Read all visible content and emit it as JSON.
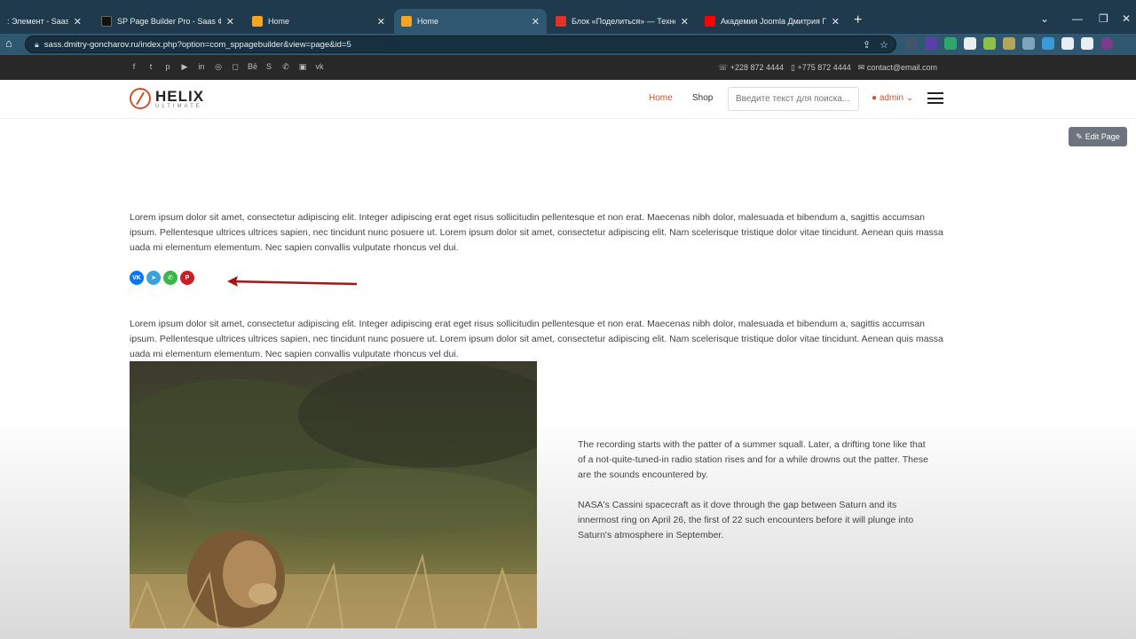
{
  "browser": {
    "tabs": [
      {
        "title": ": Элемент - Saas Фра",
        "icon_color": "#ffffff"
      },
      {
        "title": "SP Page Builder Pro - Saas Фрай",
        "icon_color": "#111111"
      },
      {
        "title": "Home",
        "icon_color": "#f4a623"
      },
      {
        "title": "Home",
        "icon_color": "#f4a623"
      },
      {
        "title": "Блок «Поделиться» — Техноло",
        "icon_color": "#e0342b"
      },
      {
        "title": "Академия Joomla Дмитрия Гон",
        "icon_color": "#ff0000"
      }
    ],
    "url": "sass.dmitry-goncharov.ru/index.php?option=com_sppagebuilder&view=page&id=5"
  },
  "topbar": {
    "phone1": "+228 872 4444",
    "phone2": "+775 872 4444",
    "email": "contact@email.com"
  },
  "header": {
    "logo_name": "HELIX",
    "logo_sub": "ULTIMATE",
    "nav_home": "Home",
    "nav_shop": "Shop",
    "search_placeholder": "Введите текст для поиска...",
    "user": "admin"
  },
  "edit_page": "Edit Page",
  "content": {
    "paragraph1": "Lorem ipsum dolor sit amet, consectetur adipiscing elit. Integer adipiscing erat eget risus sollicitudin pellentesque et non erat. Maecenas nibh dolor, malesuada et bibendum a, sagittis accumsan ipsum. Pellentesque ultrices ultrices sapien, nec tincidunt nunc posuere ut. Lorem ipsum dolor sit amet, consectetur adipiscing elit. Nam scelerisque tristique dolor vitae tincidunt. Aenean quis massa uada mi elementum elementum. Nec sapien convallis vulputate rhoncus vel dui.",
    "paragraph2": "Lorem ipsum dolor sit amet, consectetur adipiscing elit. Integer adipiscing erat eget risus sollicitudin pellentesque et non erat. Maecenas nibh dolor, malesuada et bibendum a, sagittis accumsan ipsum. Pellentesque ultrices ultrices sapien, nec tincidunt nunc posuere ut. Lorem ipsum dolor sit amet, consectetur adipiscing elit. Nam scelerisque tristique dolor vitae tincidunt. Aenean quis massa uada mi elementum elementum. Nec sapien convallis vulputate rhoncus vel dui.",
    "side1": "The recording starts with the patter of a summer squall. Later, a drifting tone like that of a not-quite-tuned-in radio station rises and for a while drowns out the patter. These are the sounds encountered by.",
    "side2": "NASA's Cassini spacecraft as it dove through the gap between Saturn and its innermost ring on April 26, the first of 22 such encounters before it will plunge into Saturn's atmosphere in September."
  },
  "share_buttons": [
    {
      "icon": "vk-icon",
      "glyph": "VK",
      "color": "#0077ff"
    },
    {
      "icon": "telegram-icon",
      "glyph": "➤",
      "color": "#3aa3d8"
    },
    {
      "icon": "whatsapp-icon",
      "glyph": "✆",
      "color": "#3cb64a"
    },
    {
      "icon": "pinterest-icon",
      "glyph": "P",
      "color": "#cb1f27"
    }
  ],
  "colors": {
    "accent": "#c7542d",
    "tabbar": "#1f3a4d",
    "topbar": "#282828"
  }
}
